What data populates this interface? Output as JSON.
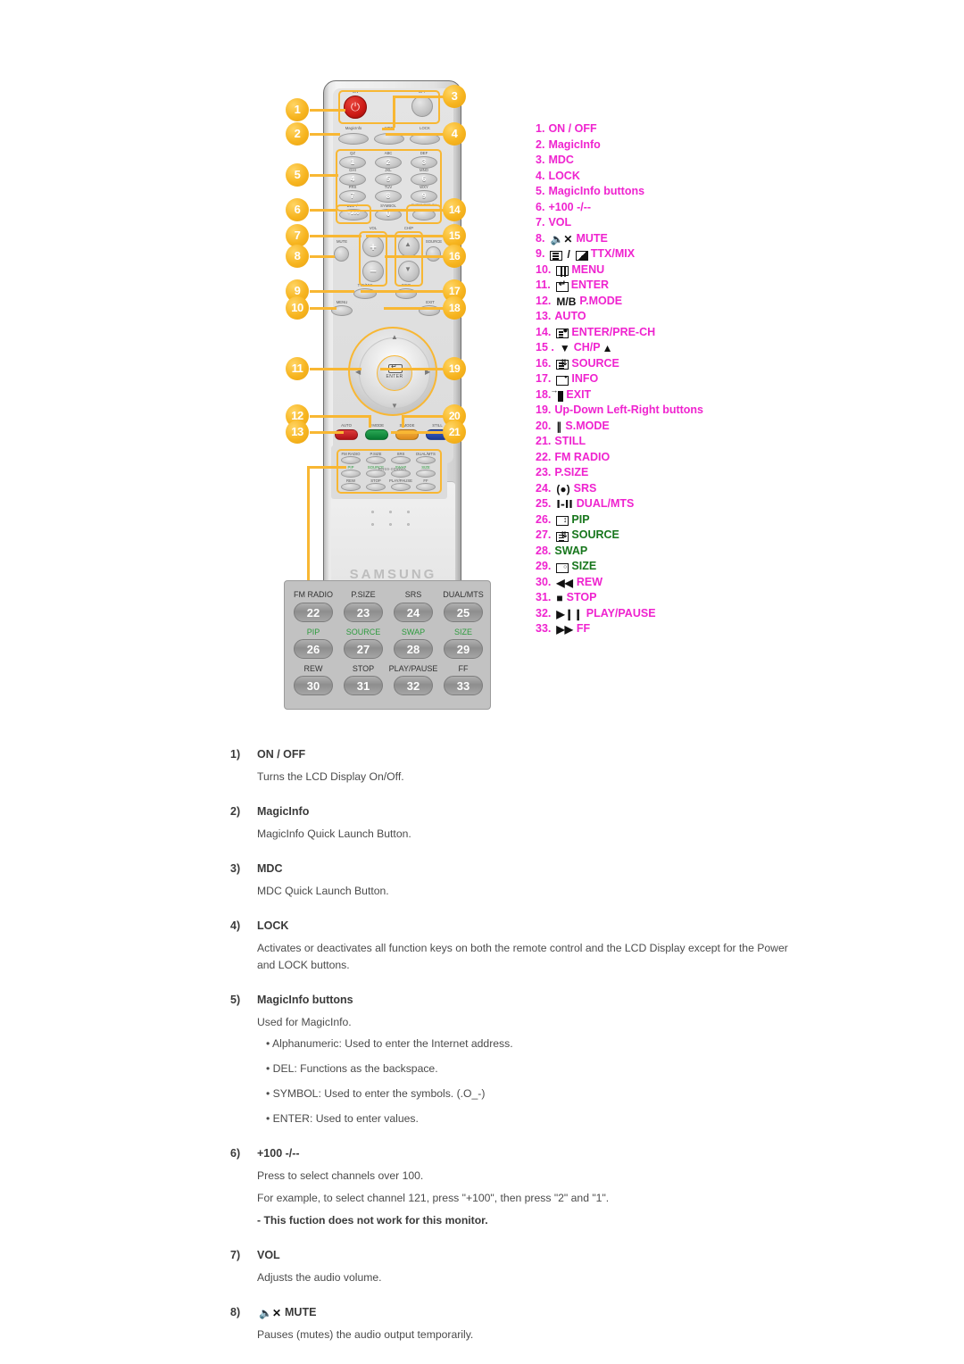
{
  "colors": {
    "magenta": "#ef23cf",
    "green": "#17761c",
    "callout": "#f7b520",
    "body_text": "#4b4b4b"
  },
  "remote": {
    "brand": "SAMSUNG",
    "model_code": "BN59-00414A",
    "power_on_label": "ON",
    "power_off_label": "OFF",
    "row2": [
      {
        "label": "MagicInfo"
      },
      {
        "label": "MDC"
      },
      {
        "label": "LOCK"
      }
    ],
    "keypad": [
      {
        "num": "1",
        "sub": "QZ"
      },
      {
        "num": "2",
        "sub": "ABC"
      },
      {
        "num": "3",
        "sub": "DEF"
      },
      {
        "num": "4",
        "sub": "GHI"
      },
      {
        "num": "5",
        "sub": "JKL"
      },
      {
        "num": "6",
        "sub": "MNO"
      },
      {
        "num": "7",
        "sub": "PRS"
      },
      {
        "num": "8",
        "sub": "TUV"
      },
      {
        "num": "9",
        "sub": "WXY"
      },
      {
        "num": "+100",
        "sub": "DEL -/--"
      },
      {
        "num": "0",
        "sub": "SYMBOL"
      }
    ],
    "prech_label": "ENTER/PRE-CH",
    "vol_label": "VOL",
    "mute_label": "MUTE",
    "chp_label": "CH/P",
    "source_label": "SOURCE",
    "ttxmix_label": "TTX/MIX",
    "info_label": "INFO",
    "menu_label": "MENU",
    "exit_label": "EXIT",
    "enter_label": "ENTER",
    "color_buttons": [
      {
        "label": "AUTO",
        "color": "#cc2026"
      },
      {
        "label": "P.MODE",
        "color": "#0f8a3a"
      },
      {
        "label": "S.MODE",
        "color": "#e8992a"
      },
      {
        "label": "STILL",
        "color": "#2449a8"
      }
    ]
  },
  "keypad_zoom": {
    "rows": [
      {
        "keys": [
          {
            "label": "FM RADIO",
            "num": "22",
            "green": false
          },
          {
            "label": "P.SIZE",
            "num": "23",
            "green": false
          },
          {
            "label": "SRS",
            "num": "24",
            "green": false
          },
          {
            "label": "DUAL/MTS",
            "num": "25",
            "green": false
          }
        ]
      },
      {
        "keys": [
          {
            "label": "PIP",
            "num": "26",
            "green": true
          },
          {
            "label": "SOURCE",
            "num": "27",
            "green": true
          },
          {
            "label": "SWAP",
            "num": "28",
            "green": true
          },
          {
            "label": "SIZE",
            "num": "29",
            "green": true
          }
        ]
      },
      {
        "keys": [
          {
            "label": "REW",
            "num": "30",
            "green": false
          },
          {
            "label": "STOP",
            "num": "31",
            "green": false
          },
          {
            "label": "PLAY/PAUSE",
            "num": "32",
            "green": false
          },
          {
            "label": "FF",
            "num": "33",
            "green": false
          }
        ]
      }
    ]
  },
  "callouts": [
    {
      "n": "1"
    },
    {
      "n": "2"
    },
    {
      "n": "3"
    },
    {
      "n": "4"
    },
    {
      "n": "5"
    },
    {
      "n": "6"
    },
    {
      "n": "7"
    },
    {
      "n": "8"
    },
    {
      "n": "9"
    },
    {
      "n": "10"
    },
    {
      "n": "11"
    },
    {
      "n": "12"
    },
    {
      "n": "13"
    },
    {
      "n": "14"
    },
    {
      "n": "15"
    },
    {
      "n": "16"
    },
    {
      "n": "17"
    },
    {
      "n": "18"
    },
    {
      "n": "19"
    },
    {
      "n": "20"
    },
    {
      "n": "21"
    }
  ],
  "legend": [
    {
      "num": "1.",
      "text": "ON / OFF",
      "icon": "none",
      "green": false
    },
    {
      "num": "2.",
      "text": "MagicInfo",
      "icon": "none",
      "green": false
    },
    {
      "num": "3.",
      "text": "MDC",
      "icon": "none",
      "green": false
    },
    {
      "num": "4.",
      "text": "LOCK",
      "icon": "none",
      "green": false
    },
    {
      "num": "5.",
      "text": "MagicInfo buttons",
      "icon": "none",
      "green": false
    },
    {
      "num": "6.",
      "text": "+100 -/--",
      "icon": "none",
      "green": false
    },
    {
      "num": "7.",
      "text": "VOL",
      "icon": "none",
      "green": false
    },
    {
      "num": "8.",
      "text": "MUTE",
      "icon": "mute-icon",
      "green": false
    },
    {
      "num": "9.",
      "text": "TTX/MIX",
      "icon": "ttx-icon",
      "green": false
    },
    {
      "num": "10.",
      "text": "MENU",
      "icon": "menu-icon",
      "green": false
    },
    {
      "num": "11.",
      "text": "ENTER",
      "icon": "enter-icon",
      "green": false
    },
    {
      "num": "12.",
      "text": "P.MODE",
      "icon": "mb-icon",
      "green": false
    },
    {
      "num": "13.",
      "text": "AUTO",
      "icon": "none",
      "green": false
    },
    {
      "num": "14.",
      "text": "ENTER/PRE-CH",
      "icon": "prech-icon",
      "green": false
    },
    {
      "num": "15 .",
      "text": "CH/P",
      "icon": "chp-icon",
      "green": false
    },
    {
      "num": "16.",
      "text": "SOURCE",
      "icon": "source-icon",
      "green": false
    },
    {
      "num": "17.",
      "text": "INFO",
      "icon": "info-icon",
      "green": false
    },
    {
      "num": "18.",
      "text": "EXIT",
      "icon": "exit-icon",
      "green": false
    },
    {
      "num": "19.",
      "text": "Up-Down Left-Right buttons",
      "icon": "none",
      "green": false
    },
    {
      "num": "20.",
      "text": "S.MODE",
      "icon": "smode-icon",
      "green": false
    },
    {
      "num": "21.",
      "text": "STILL",
      "icon": "none",
      "green": false
    },
    {
      "num": "22.",
      "text": "FM RADIO",
      "icon": "none",
      "green": false
    },
    {
      "num": "23.",
      "text": "P.SIZE",
      "icon": "none",
      "green": false
    },
    {
      "num": "24.",
      "text": "SRS",
      "icon": "srs-icon",
      "green": false
    },
    {
      "num": "25.",
      "text": "DUAL/MTS",
      "icon": "dual-icon",
      "green": false
    },
    {
      "num": "26.",
      "text": "PIP",
      "icon": "pip-icon",
      "green": true
    },
    {
      "num": "27.",
      "text": "SOURCE",
      "icon": "source-icon",
      "green": true
    },
    {
      "num": "28.",
      "text": "SWAP",
      "icon": "none",
      "green": true
    },
    {
      "num": "29.",
      "text": "SIZE",
      "icon": "size-icon",
      "green": true
    },
    {
      "num": "30.",
      "text": "REW",
      "icon": "rew-icon",
      "green": false
    },
    {
      "num": "31.",
      "text": "STOP",
      "icon": "stop-icon",
      "green": false
    },
    {
      "num": "32.",
      "text": "PLAY/PAUSE",
      "icon": "playpause-icon",
      "green": false
    },
    {
      "num": "33.",
      "text": "FF",
      "icon": "ff-icon",
      "green": false
    }
  ],
  "descriptions": [
    {
      "num": "1)",
      "title": "ON / OFF",
      "icon": "none",
      "paras": [
        "Turns the LCD Display On/Off."
      ],
      "bullets": [],
      "note": ""
    },
    {
      "num": "2)",
      "title": "MagicInfo",
      "icon": "none",
      "paras": [
        "MagicInfo Quick Launch Button."
      ],
      "bullets": [],
      "note": ""
    },
    {
      "num": "3)",
      "title": "MDC",
      "icon": "none",
      "paras": [
        "MDC Quick Launch Button."
      ],
      "bullets": [],
      "note": ""
    },
    {
      "num": "4)",
      "title": "LOCK",
      "icon": "none",
      "paras": [
        "Activates or deactivates all function keys on both the remote control and the LCD Display except for the Power and LOCK buttons."
      ],
      "bullets": [],
      "note": ""
    },
    {
      "num": "5)",
      "title": "MagicInfo buttons",
      "icon": "none",
      "paras": [
        "Used for MagicInfo."
      ],
      "bullets": [
        "Alphanumeric: Used to enter the Internet address.",
        "DEL: Functions as the backspace.",
        "SYMBOL: Used to enter the symbols. (.O_-)",
        "ENTER: Used to enter values."
      ],
      "note": ""
    },
    {
      "num": "6)",
      "title": "+100 -/--",
      "icon": "none",
      "paras": [
        "Press to select channels over 100.",
        "For example, to select channel 121, press \"+100\", then press \"2\" and \"1\"."
      ],
      "bullets": [],
      "note": "- This fuction does not work for this monitor."
    },
    {
      "num": "7)",
      "title": "VOL",
      "icon": "none",
      "paras": [
        "Adjusts the audio volume."
      ],
      "bullets": [],
      "note": ""
    },
    {
      "num": "8)",
      "title": "MUTE",
      "icon": "mute-icon",
      "paras": [
        "Pauses (mutes) the audio output temporarily."
      ],
      "bullets": [],
      "note": ""
    }
  ]
}
